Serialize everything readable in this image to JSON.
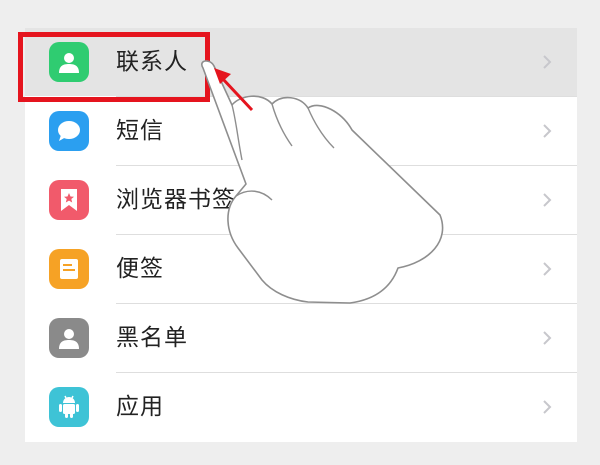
{
  "settings_list": {
    "items": [
      {
        "label": "联系人",
        "icon": "contact-person-icon",
        "color": "#2fcc71",
        "highlighted": true
      },
      {
        "label": "短信",
        "icon": "message-bubble-icon",
        "color": "#2b9ff0",
        "highlighted": false
      },
      {
        "label": "浏览器书签",
        "icon": "bookmark-icon",
        "color": "#f15a6b",
        "highlighted": false
      },
      {
        "label": "便签",
        "icon": "note-icon",
        "color": "#f6a225",
        "highlighted": false
      },
      {
        "label": "黑名单",
        "icon": "blacklist-person-icon",
        "color": "#8a8a8a",
        "highlighted": false
      },
      {
        "label": "应用",
        "icon": "android-app-icon",
        "color": "#3ec3d6",
        "highlighted": false
      }
    ]
  },
  "annotation": {
    "box_color": "#e5141e",
    "arrow_color": "#e5141e",
    "hand": "pointing-hand-icon"
  },
  "colors": {
    "background": "#eeeeee",
    "list_background": "#ffffff",
    "highlight_row": "#e4e4e4",
    "chevron": "#c7c7cc"
  }
}
